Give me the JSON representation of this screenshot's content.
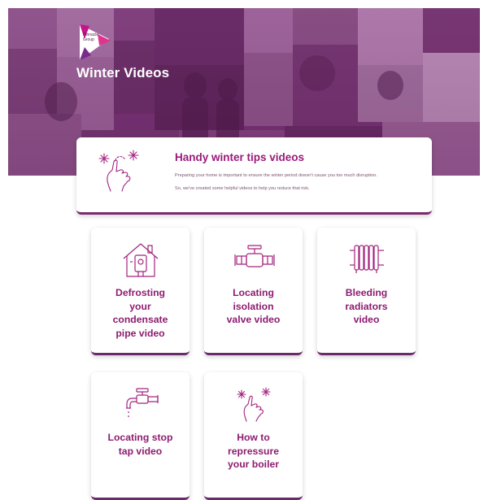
{
  "hero": {
    "title": "Winter Videos",
    "logo_text_line1": "Pinnacle",
    "logo_text_line2": "Group"
  },
  "intro": {
    "title": "Handy winter tips videos",
    "text_line1": "Preparing your home is important to ensure the winter period doesn't cause you too much disruption.",
    "text_line2": "So, we've created some helpful videos to help you reduce that risk.",
    "icon": "hand-snowflake-icon"
  },
  "videos": [
    {
      "label_lines": [
        "Defrosting",
        "your",
        "condensate",
        "pipe video"
      ],
      "icon": "house-boiler-icon"
    },
    {
      "label_lines": [
        "Locating",
        "isolation",
        "valve video"
      ],
      "icon": "valve-icon"
    },
    {
      "label_lines": [
        "Bleeding",
        "radiators",
        "video"
      ],
      "icon": "radiator-icon"
    },
    {
      "label_lines": [
        "Locating stop",
        "tap video"
      ],
      "icon": "tap-icon"
    },
    {
      "label_lines": [
        "How to",
        "repressure",
        "your boiler"
      ],
      "icon": "hand-snowflake-icon"
    }
  ],
  "colors": {
    "accent": "#9a1a7b",
    "card_border": "#6b2b6b",
    "hero_tint": "#6e2f6c"
  }
}
